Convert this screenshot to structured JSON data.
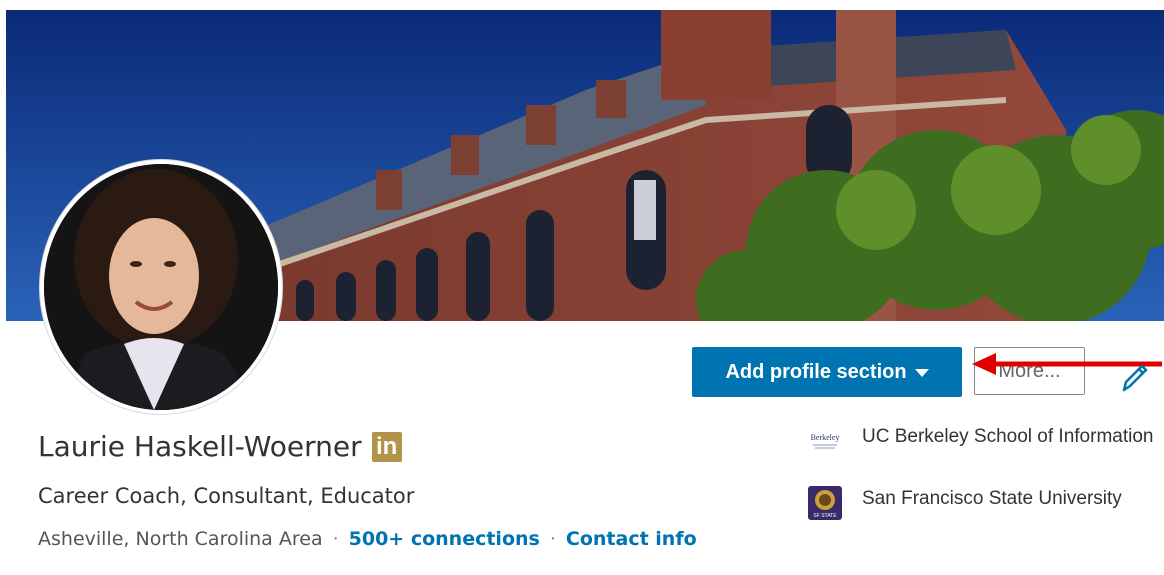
{
  "profile": {
    "name": "Laurie Haskell-Woerner",
    "badge_text": "in",
    "headline": "Career Coach, Consultant, Educator",
    "location": "Asheville, North Carolina Area",
    "separator": "·",
    "connections": "500+ connections",
    "contact_info": "Contact info"
  },
  "actions": {
    "add_section_label": "Add profile section",
    "more_label": "More..."
  },
  "education": [
    {
      "school": "UC Berkeley School of Information",
      "logo_text": "Berkeley",
      "logo_icon": "berkeley-logo"
    },
    {
      "school": "San Francisco State University",
      "logo_text": "SF STATE",
      "logo_icon": "sfsu-seal"
    }
  ],
  "colors": {
    "primary": "#0073b1",
    "badge": "#b1934a",
    "annotation_arrow": "#e00000"
  },
  "icons": {
    "caret": "caret-down-icon",
    "edit": "pencil-icon",
    "annotation": "red-arrow-icon"
  }
}
